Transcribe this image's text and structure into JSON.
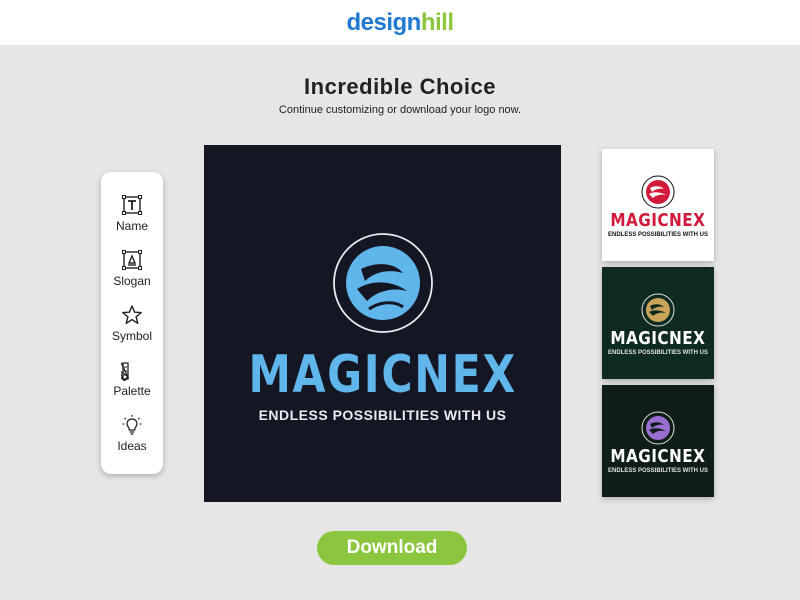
{
  "header": {
    "brand_part1": "design",
    "brand_part2": "hill",
    "brand_colors": {
      "primary": "#1f78d1",
      "accent": "#8cc63f"
    }
  },
  "main": {
    "title": "Incredible Choice",
    "subtitle": "Continue customizing or download your logo now."
  },
  "toolbar": {
    "items": [
      {
        "label": "Name",
        "icon": "text-icon"
      },
      {
        "label": "Slogan",
        "icon": "slogan-icon"
      },
      {
        "label": "Symbol",
        "icon": "star-icon"
      },
      {
        "label": "Palette",
        "icon": "palette-icon"
      },
      {
        "label": "Ideas",
        "icon": "lightbulb-icon"
      }
    ]
  },
  "preview": {
    "logo_name": "MAGICNEX",
    "slogan": "ENDLESS POSSIBILITIES WITH US",
    "background": "#141623",
    "name_color": "#60b5ea",
    "emblem_icon": "swirl-flame-icon"
  },
  "variants": [
    {
      "name": "MAGICNEX",
      "slogan": "ENDLESS POSSIBILITIES WITH US",
      "background": "#ffffff",
      "name_color": "#d21a3a",
      "emblem_color": "#d21a3a"
    },
    {
      "name": "MAGICNEX",
      "slogan": "ENDLESS POSSIBILITIES WITH US",
      "background": "#0f2a1f",
      "name_color": "#ffffff",
      "emblem_color": "#c9a35a"
    },
    {
      "name": "MAGICNEX",
      "slogan": "ENDLESS POSSIBILITIES WITH US",
      "background": "#0e1d18",
      "name_color": "#ffffff",
      "emblem_color": "#9b6fd1"
    }
  ],
  "actions": {
    "download_label": "Download",
    "download_color": "#8cc63f"
  }
}
